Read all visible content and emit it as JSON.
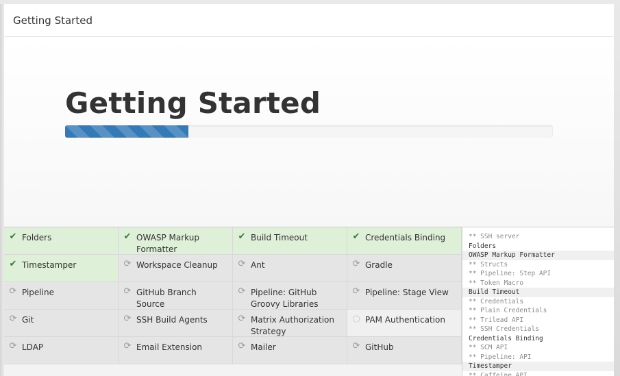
{
  "header": {
    "title": "Getting Started"
  },
  "hero": {
    "title": "Getting Started",
    "progress_percent": 25.3
  },
  "plugins": [
    {
      "name": "Folders",
      "status": "success",
      "icon": "check-icon"
    },
    {
      "name": "OWASP Markup Formatter",
      "status": "success",
      "icon": "check-icon"
    },
    {
      "name": "Build Timeout",
      "status": "success",
      "icon": "check-icon"
    },
    {
      "name": "Credentials Binding",
      "status": "success",
      "icon": "check-icon"
    },
    {
      "name": "Timestamper",
      "status": "success",
      "icon": "check-icon"
    },
    {
      "name": "Workspace Cleanup",
      "status": "installing",
      "icon": "refresh-icon"
    },
    {
      "name": "Ant",
      "status": "installing",
      "icon": "refresh-icon"
    },
    {
      "name": "Gradle",
      "status": "installing",
      "icon": "refresh-icon"
    },
    {
      "name": "Pipeline",
      "status": "installing",
      "icon": "refresh-icon"
    },
    {
      "name": "GitHub Branch Source",
      "status": "installing",
      "icon": "refresh-icon"
    },
    {
      "name": "Pipeline: GitHub Groovy Libraries",
      "status": "installing",
      "icon": "refresh-icon"
    },
    {
      "name": "Pipeline: Stage View",
      "status": "installing",
      "icon": "refresh-icon"
    },
    {
      "name": "Git",
      "status": "installing",
      "icon": "refresh-icon"
    },
    {
      "name": "SSH Build Agents",
      "status": "installing",
      "icon": "refresh-icon"
    },
    {
      "name": "Matrix Authorization Strategy",
      "status": "installing",
      "icon": "refresh-icon"
    },
    {
      "name": "PAM Authentication",
      "status": "pending",
      "icon": "circle-icon"
    },
    {
      "name": "LDAP",
      "status": "installing",
      "icon": "refresh-icon"
    },
    {
      "name": "Email Extension",
      "status": "installing",
      "icon": "refresh-icon"
    },
    {
      "name": "Mailer",
      "status": "installing",
      "icon": "refresh-icon"
    },
    {
      "name": "GitHub",
      "status": "installing",
      "icon": "refresh-icon"
    }
  ],
  "log": [
    {
      "text": "** SSH server",
      "type": "dep"
    },
    {
      "text": "Folders",
      "type": "plugin"
    },
    {
      "text": "OWASP Markup Formatter",
      "type": "plugin",
      "shade": true
    },
    {
      "text": "** Structs",
      "type": "dep"
    },
    {
      "text": "** Pipeline: Step API",
      "type": "dep"
    },
    {
      "text": "** Token Macro",
      "type": "dep"
    },
    {
      "text": "Build Timeout",
      "type": "plugin",
      "shade": true
    },
    {
      "text": "** Credentials",
      "type": "dep"
    },
    {
      "text": "** Plain Credentials",
      "type": "dep"
    },
    {
      "text": "** Trilead API",
      "type": "dep"
    },
    {
      "text": "** SSH Credentials",
      "type": "dep"
    },
    {
      "text": "Credentials Binding",
      "type": "plugin"
    },
    {
      "text": "** SCM API",
      "type": "dep"
    },
    {
      "text": "** Pipeline: API",
      "type": "dep"
    },
    {
      "text": "Timestamper",
      "type": "plugin",
      "shade": true
    },
    {
      "text": "** Caffeine API",
      "type": "dep"
    }
  ]
}
